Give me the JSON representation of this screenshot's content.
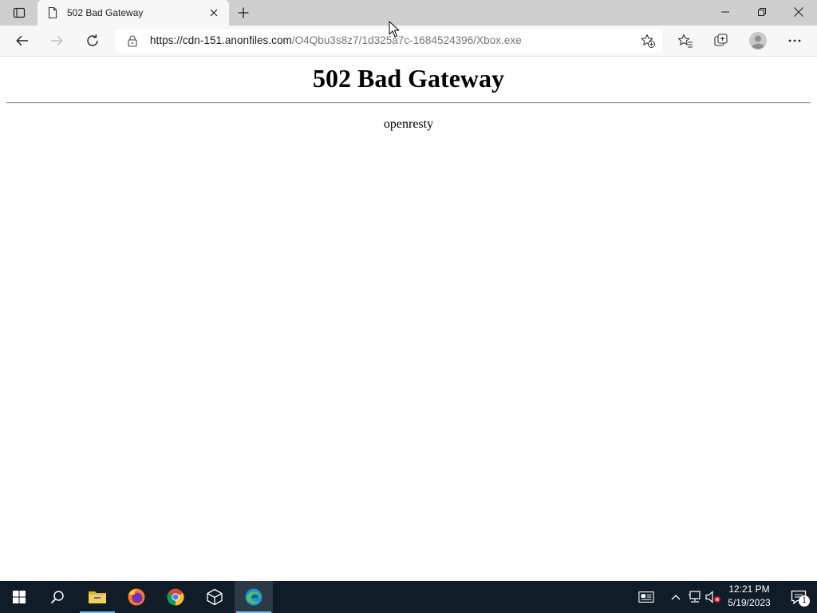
{
  "browser": {
    "tab": {
      "title": "502 Bad Gateway",
      "favicon": "page-icon",
      "close_icon": "close-icon"
    },
    "new_tab_icon": "plus-icon",
    "tab_actions_icon": "tab-actions-icon",
    "window_controls": [
      "minimize-icon",
      "restore-icon",
      "close-icon"
    ],
    "nav": {
      "back": "back-arrow-icon",
      "forward": "forward-arrow-icon",
      "refresh": "refresh-icon"
    },
    "address": {
      "host": "https://cdn-151.anonfiles.com",
      "path": "/O4Qbu3s8z7/1d325a7c-1684524396/Xbox.exe",
      "lock_icon": "lock-icon",
      "add_favorite_icon": "star-add-icon"
    },
    "toolbar_icons": [
      "favorites-icon",
      "collections-icon",
      "profile-icon",
      "more-icon"
    ]
  },
  "page": {
    "heading": "502 Bad Gateway",
    "server": "openresty"
  },
  "taskbar": {
    "apps": [
      "start-icon",
      "search-icon",
      "file-explorer-icon",
      "firefox-icon",
      "chrome-icon",
      "3d-viewer-icon",
      "edge-icon"
    ],
    "active_app": "edge-icon",
    "tray": [
      "news-icon",
      "chevron-up-icon",
      "network-icon",
      "volume-muted-icon"
    ],
    "time": "12:21 PM",
    "date": "5/19/2023",
    "notification_count": "1"
  },
  "colors": {
    "titlebar": "#cfcfcf",
    "toolbar": "#f7f7f7",
    "taskbar": "#101c28",
    "accent": "#76b9ed"
  }
}
